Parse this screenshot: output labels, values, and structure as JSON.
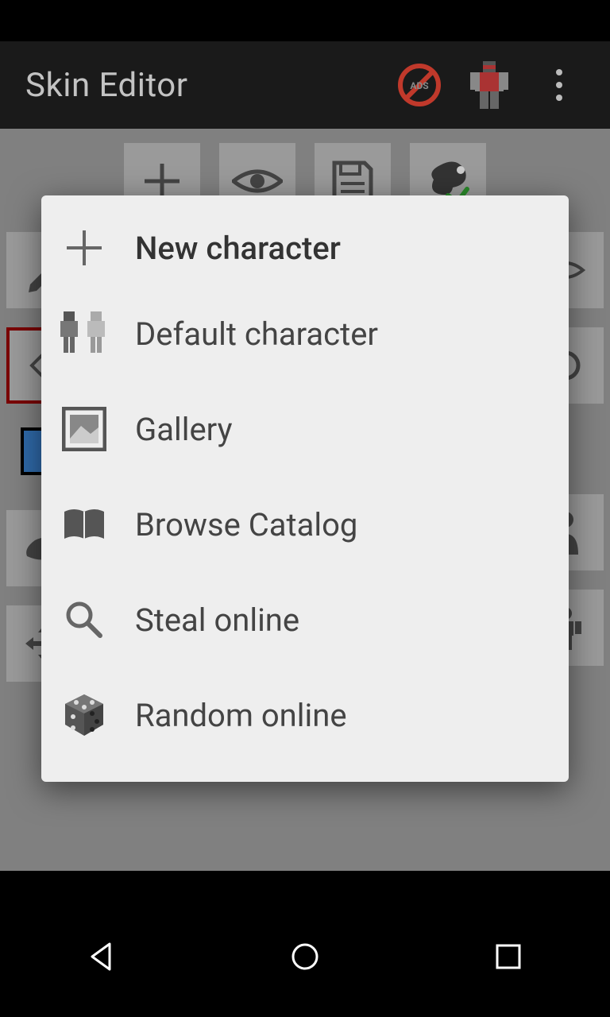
{
  "actionbar": {
    "title": "Skin Editor",
    "no_ads_text": "ADS"
  },
  "menu": {
    "items": [
      {
        "label": "New character"
      },
      {
        "label": "Default character"
      },
      {
        "label": "Gallery"
      },
      {
        "label": "Browse Catalog"
      },
      {
        "label": "Steal online"
      },
      {
        "label": "Random online"
      }
    ]
  }
}
